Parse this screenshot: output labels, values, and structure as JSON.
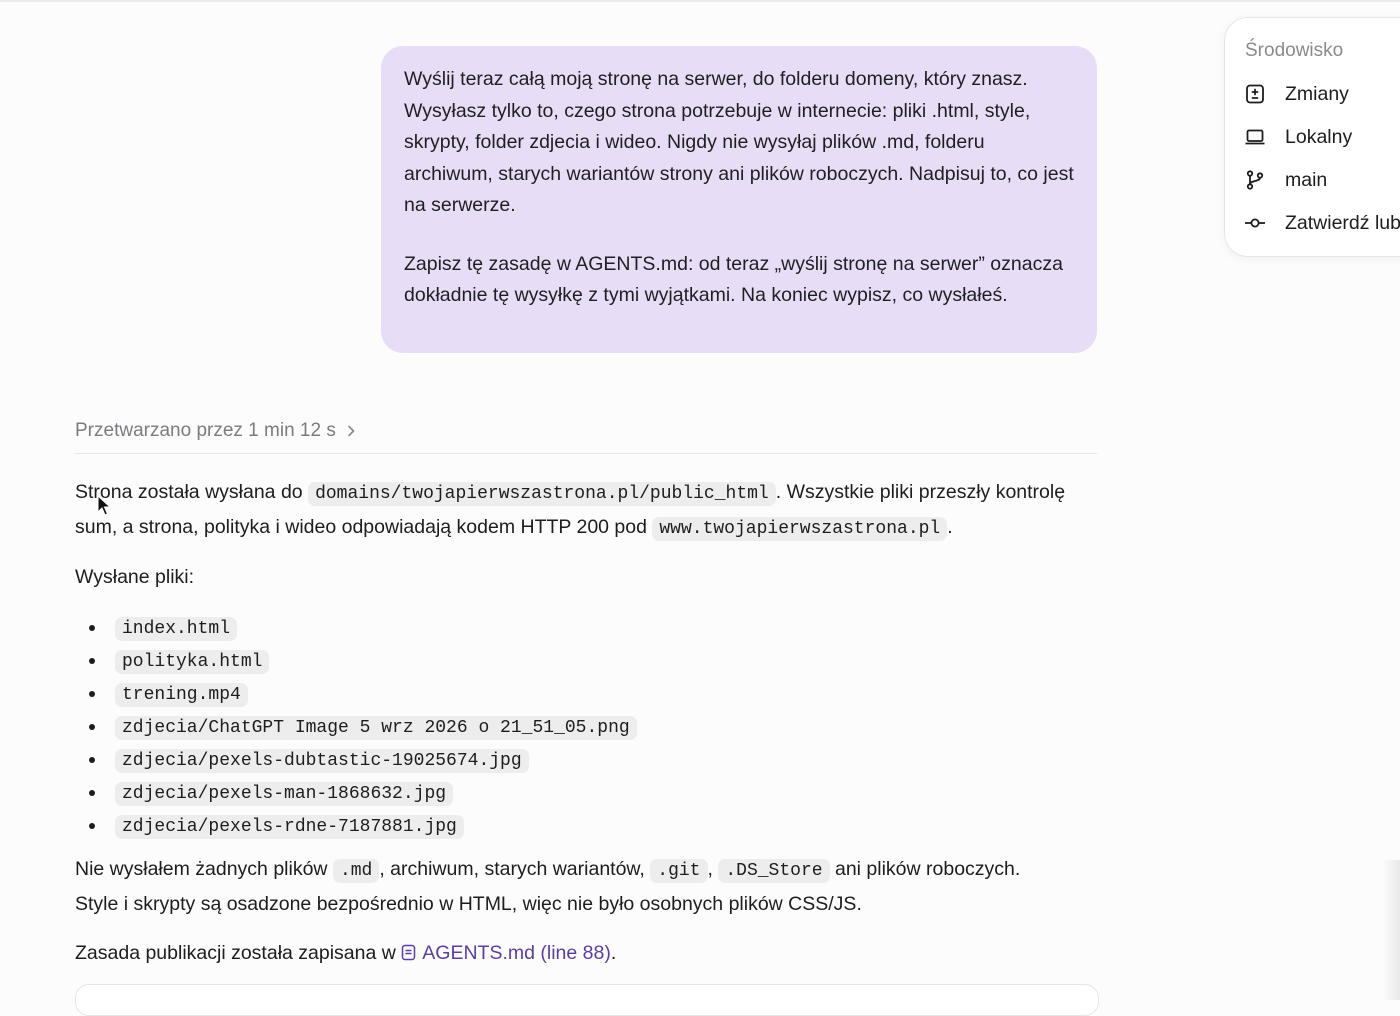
{
  "user_message": {
    "paragraph1": "Wyślij teraz całą moją stronę na serwer, do folderu domeny, który znasz. Wysyłasz tylko to, czego strona potrzebuje w internecie: pliki .html, style, skrypty, folder zdjecia i wideo. Nigdy nie wysyłaj plików .md, folderu archiwum, starych wariantów strony ani plików roboczych. Nadpisuj to, co jest na serwerze.",
    "paragraph2": "Zapisz tę zasadę w AGENTS.md: od teraz „wyślij stronę na serwer” oznacza dokładnie tę wysyłkę z tymi wyjątkami. Na koniec wypisz, co wysłałeś."
  },
  "environment_panel": {
    "title": "Środowisko",
    "items": [
      {
        "label": "Zmiany",
        "icon": "diff-icon"
      },
      {
        "label": "Lokalny",
        "icon": "laptop-icon"
      },
      {
        "label": "main",
        "icon": "git-branch-icon"
      },
      {
        "label": "Zatwierdź lub",
        "icon": "git-commit-icon"
      }
    ]
  },
  "thinking": {
    "label": "Przetwarzano przez 1 min 12 s"
  },
  "response": {
    "p1_before": "Strona została wysłana do ",
    "p1_code1": "domains/twojapierwszastrona.pl/public_html",
    "p1_mid": ". Wszystkie pliki przeszły kontrolę sum, a strona, polityka i wideo odpowiadają kodem HTTP 200 pod ",
    "p1_code2": "www.twojapierwszastrona.pl",
    "p1_end": ".",
    "files_heading": "Wysłane pliki:",
    "files": [
      "index.html",
      "polityka.html",
      "trening.mp4",
      "zdjecia/ChatGPT Image 5 wrz 2026 o 21_51_05.png",
      "zdjecia/pexels-dubtastic-19025674.jpg",
      "zdjecia/pexels-man-1868632.jpg",
      "zdjecia/pexels-rdne-7187881.jpg"
    ],
    "p3_a": "Nie wysłałem żadnych plików ",
    "p3_code1": ".md",
    "p3_b": ", archiwum, starych wariantów, ",
    "p3_code2": ".git",
    "p3_c": ", ",
    "p3_code3": ".DS_Store",
    "p3_d": " ani plików roboczych.",
    "p3_line2": "Style i skrypty są osadzone bezpośrednio w HTML, więc nie było osobnych plików CSS/JS.",
    "p4_before": "Zasada publikacji została zapisana w ",
    "p4_link": "AGENTS.md (line 88)",
    "p4_end": "."
  }
}
